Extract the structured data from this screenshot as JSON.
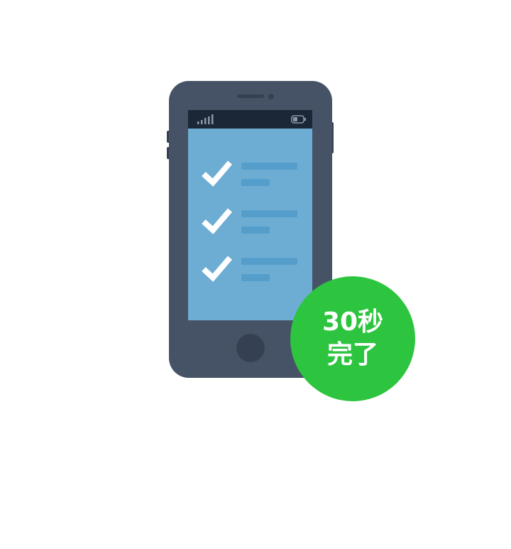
{
  "badge": {
    "line1": "30秒",
    "line2": "完了",
    "color": "#2dc43f"
  },
  "phone": {
    "body_color": "#465366",
    "screen_color": "#6dadd4",
    "checklist": [
      {
        "icon": "check-icon",
        "checked": true
      },
      {
        "icon": "check-icon",
        "checked": true
      },
      {
        "icon": "check-icon",
        "checked": true
      }
    ],
    "status_icons": [
      "signal-icon",
      "battery-icon"
    ]
  }
}
